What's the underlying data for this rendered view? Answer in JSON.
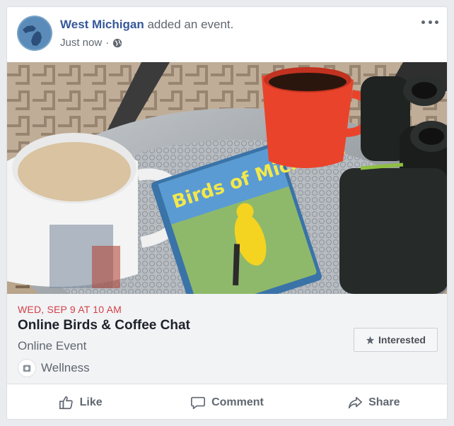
{
  "post": {
    "page_name": "West Michigan",
    "action_text": "added an event.",
    "timestamp": "Just now",
    "separator": "·",
    "privacy_icon": "globe-icon",
    "more_icon": "more-options-icon"
  },
  "event": {
    "date": "WED, SEP 9 AT 10 AM",
    "title": "Online Birds & Coffee Chat",
    "type": "Online Event",
    "category": "Wellness",
    "category_icon": "wellness-icon",
    "interested_label": "Interested",
    "interested_icon": "star-icon",
    "cover_book_text": "Birds of Michigan"
  },
  "actions": {
    "like": "Like",
    "comment": "Comment",
    "share": "Share"
  },
  "colors": {
    "page_name": "#365899",
    "date": "#d23f47",
    "text_secondary": "#606770",
    "background": "#e9ebee"
  }
}
